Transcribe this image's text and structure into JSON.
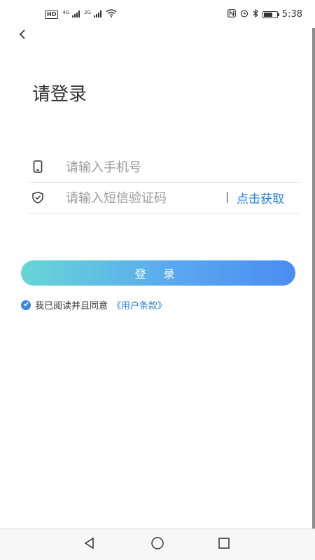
{
  "status_bar": {
    "hd_badge": "HD",
    "network_1": "4G",
    "network_2": "2G",
    "time": "5:38",
    "battery_level": 0.7
  },
  "header": {
    "title": "请登录"
  },
  "form": {
    "phone_placeholder": "请输入手机号",
    "code_placeholder": "请输入短信验证码",
    "get_code_label": "点击获取",
    "login_label": "登 录"
  },
  "agreement": {
    "text": "我已阅读并且同意",
    "link": "《用户条款》",
    "checked": true
  },
  "colors": {
    "accent": "#1f7fd8",
    "button_gradient_start": "#67d6d6",
    "button_gradient_end": "#4a8df2"
  }
}
